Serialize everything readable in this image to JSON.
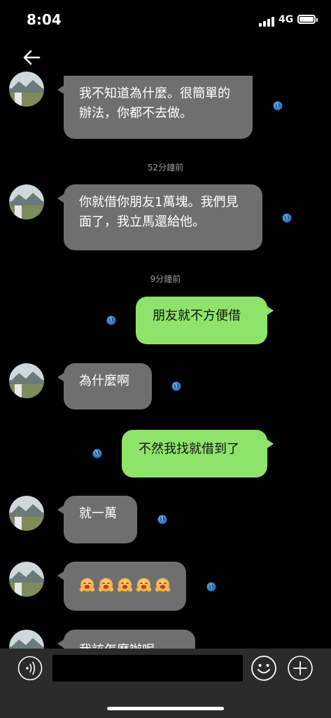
{
  "status_bar": {
    "time": "8:04",
    "network": "4G"
  },
  "header": {
    "back_icon": "arrow-left-icon"
  },
  "messages": [
    {
      "side": "in",
      "text": "我不知道為什麼。很簡單的辦法，你都不去做。"
    },
    {
      "type": "time",
      "text": "52分鐘前"
    },
    {
      "side": "in",
      "text": "你就借你朋友1萬塊。我們見面了，我立馬還給他。"
    },
    {
      "type": "time",
      "text": "9分鐘前"
    },
    {
      "side": "out",
      "text": "朋友就不方便借"
    },
    {
      "side": "in",
      "text": "為什麼啊"
    },
    {
      "side": "out",
      "text": "不然我找就借到了"
    },
    {
      "side": "in",
      "text": "就一萬"
    },
    {
      "side": "in",
      "emoji": [
        "hugging-face-emoji",
        "hugging-face-emoji",
        "hugging-face-emoji",
        "hugging-face-emoji",
        "hugging-face-emoji"
      ]
    },
    {
      "side": "in",
      "text": "我該怎麼辦呢",
      "partial": true
    }
  ],
  "composer": {
    "input_placeholder": "",
    "voice_icon": "voice-icon",
    "emoji_icon": "smiley-icon",
    "plus_icon": "plus-icon"
  },
  "colors": {
    "incoming_bubble": "#6f6f6f",
    "outgoing_bubble": "#8ee36b",
    "background": "#000000",
    "composer": "#2b2b2b"
  }
}
